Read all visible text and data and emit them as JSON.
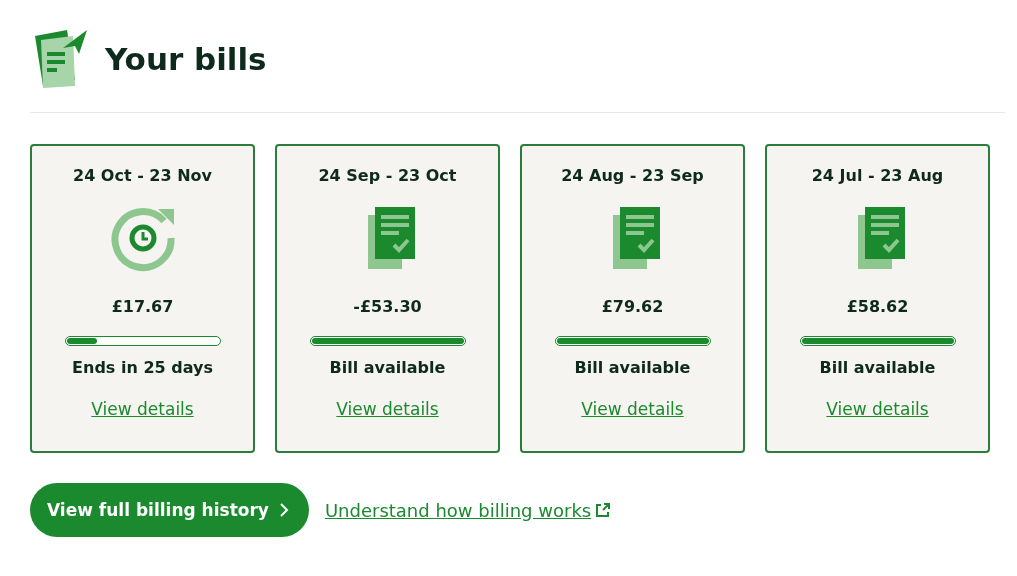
{
  "title": "Your bills",
  "bills": [
    {
      "period": "24 Oct - 23 Nov",
      "kind": "current",
      "amount": "£17.67",
      "level": 0.2,
      "status": "Ends in 25 days",
      "link": "View details"
    },
    {
      "period": "24 Sep - 23 Oct",
      "kind": "bill",
      "amount": "-£53.30",
      "level": 1,
      "status": "Bill available",
      "link": "View details"
    },
    {
      "period": "24 Aug - 23 Sep",
      "kind": "bill",
      "amount": "£79.62",
      "level": 1,
      "status": "Bill available",
      "link": "View details"
    },
    {
      "period": "24 Jul - 23 Aug",
      "kind": "bill",
      "amount": "£58.62",
      "level": 1,
      "status": "Bill available",
      "link": "View details"
    }
  ],
  "history_button": "View full billing history",
  "help_link": "Understand how billing works"
}
